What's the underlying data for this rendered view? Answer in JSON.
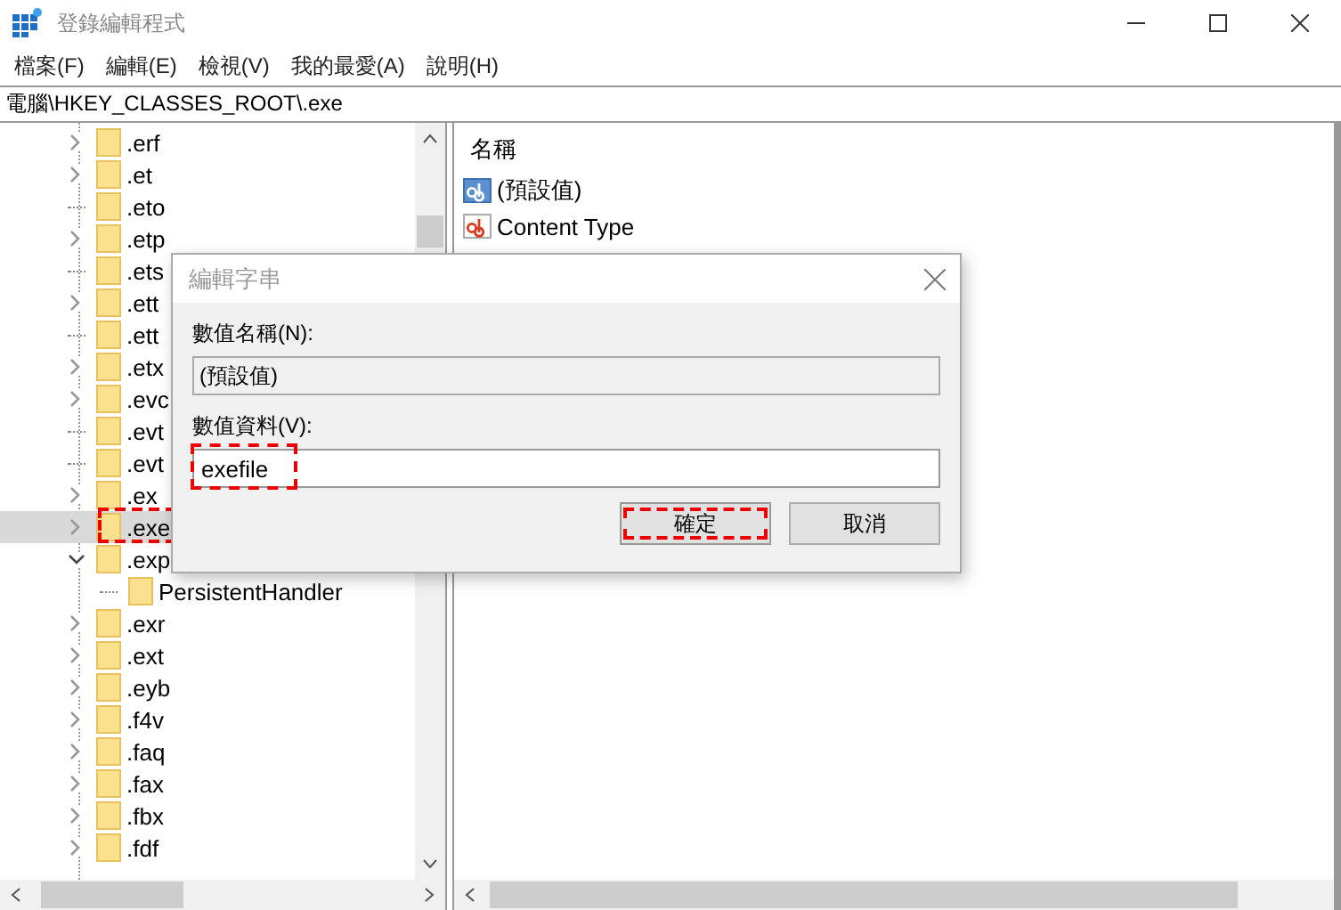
{
  "window": {
    "title": "登錄編輯程式"
  },
  "menu": [
    "檔案(F)",
    "編輯(E)",
    "檢視(V)",
    "我的最愛(A)",
    "說明(H)"
  ],
  "address": "電腦\\HKEY_CLASSES_ROOT\\.exe",
  "tree": [
    {
      "label": ".erf",
      "kind": "collapsed",
      "selected": false
    },
    {
      "label": ".et",
      "kind": "collapsed",
      "selected": false
    },
    {
      "label": ".eto",
      "kind": "leaf",
      "selected": false
    },
    {
      "label": ".etp",
      "kind": "collapsed",
      "selected": false
    },
    {
      "label": ".ets",
      "kind": "leaf",
      "selected": false
    },
    {
      "label": ".ett",
      "kind": "collapsed",
      "selected": false
    },
    {
      "label": ".ett",
      "kind": "leaf",
      "selected": false
    },
    {
      "label": ".etx",
      "kind": "collapsed",
      "selected": false
    },
    {
      "label": ".evc",
      "kind": "collapsed",
      "selected": false
    },
    {
      "label": ".evt",
      "kind": "leaf",
      "selected": false
    },
    {
      "label": ".evt",
      "kind": "leaf",
      "selected": false
    },
    {
      "label": ".ex",
      "kind": "collapsed",
      "selected": false
    },
    {
      "label": ".exe",
      "kind": "collapsed",
      "selected": true,
      "highlighted": true
    },
    {
      "label": ".exp",
      "kind": "expanded",
      "selected": false,
      "children": [
        {
          "label": "PersistentHandler",
          "kind": "leaf",
          "selected": false
        }
      ]
    },
    {
      "label": ".exr",
      "kind": "collapsed",
      "selected": false
    },
    {
      "label": ".ext",
      "kind": "collapsed",
      "selected": false
    },
    {
      "label": ".eyb",
      "kind": "collapsed",
      "selected": false
    },
    {
      "label": ".f4v",
      "kind": "collapsed",
      "selected": false
    },
    {
      "label": ".faq",
      "kind": "collapsed",
      "selected": false
    },
    {
      "label": ".fax",
      "kind": "collapsed",
      "selected": false
    },
    {
      "label": ".fbx",
      "kind": "collapsed",
      "selected": false
    },
    {
      "label": ".fdf",
      "kind": "collapsed",
      "selected": false
    }
  ],
  "values": {
    "column_header": "名稱",
    "rows": [
      {
        "name": "(預設值)",
        "kind": "default"
      },
      {
        "name": "Content Type",
        "kind": "string"
      }
    ]
  },
  "dialog": {
    "title": "編輯字串",
    "name_label": "數值名稱(N):",
    "name_value": "(預設值)",
    "data_label": "數值資料(V):",
    "data_value": "exefile",
    "data_highlighted": true,
    "buttons": [
      {
        "label": "確定",
        "kind": "primary",
        "highlighted": true
      },
      {
        "label": "取消",
        "kind": "normal",
        "highlighted": false
      }
    ]
  }
}
